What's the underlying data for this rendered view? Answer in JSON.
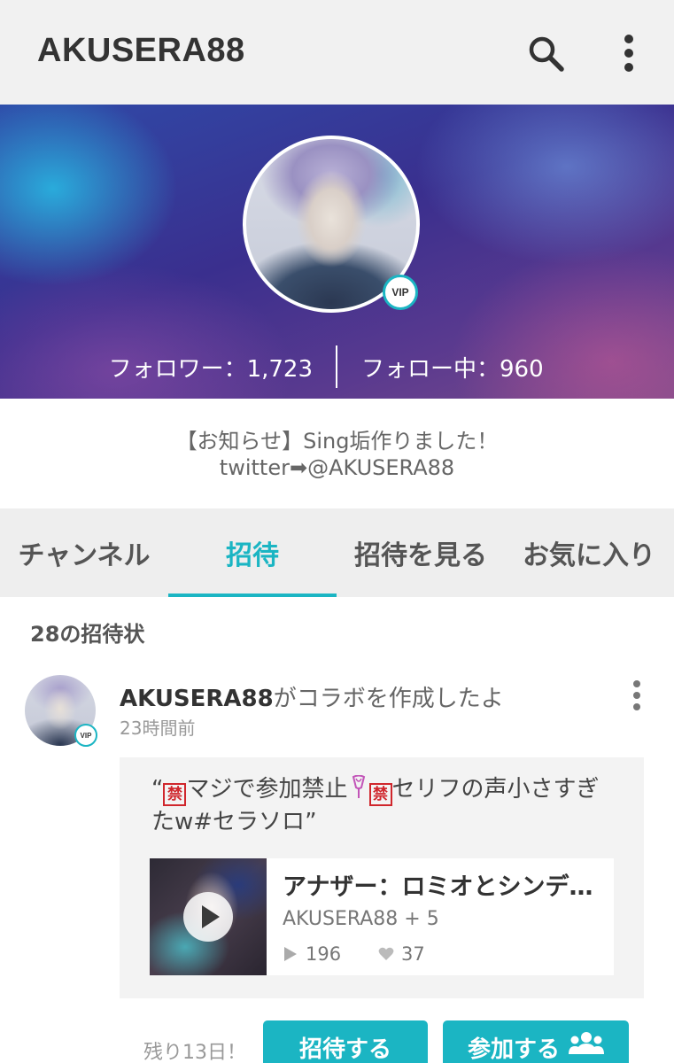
{
  "appbar": {
    "title": "AKUSERA88",
    "search_icon": "search-icon",
    "more_icon": "more-vert-icon"
  },
  "profile": {
    "vip": "VIP",
    "followers": "フォロワー：1,723",
    "following": "フォロー中：960",
    "bio_line1": "【お知らせ】Sing垢作りました！",
    "bio_line2": "twitter➡@AKUSERA88"
  },
  "tabs": [
    {
      "label": "チャンネル"
    },
    {
      "label": "招待",
      "active": true
    },
    {
      "label": "招待を見る"
    },
    {
      "label": "お気に入り"
    }
  ],
  "feed": {
    "section_title": "28の招待状",
    "post": {
      "user": "AKUSERA88",
      "action": "がコラボを作成したよ",
      "time": "23時間前",
      "vip": "VIP",
      "quote_open": "“",
      "kin1": "禁",
      "quote_part1": "マジで参加禁止",
      "kin2": "禁",
      "quote_part2": "セリフの声小さすぎたw#セラソロ",
      "quote_close": "”",
      "song": {
        "title": "アナザー：ロミオとシンデ…",
        "artist": "AKUSERA88 + 5",
        "plays": "196",
        "likes": "37"
      },
      "remaining": "残り13日！",
      "invite_button": "招待する",
      "join_button": "参加する"
    }
  },
  "colors": {
    "accent": "#1bb5c3",
    "appbar_bg": "#f1f1f1",
    "tab_bg": "#eeeeee",
    "kin_red": "#d0262c"
  }
}
